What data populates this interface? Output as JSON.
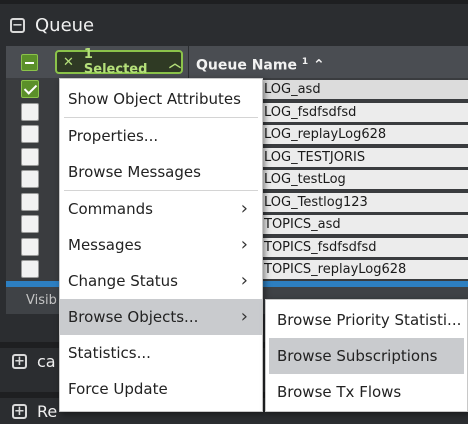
{
  "panel": {
    "title": "Queue",
    "collapse_icon": "minus-square-icon"
  },
  "grid": {
    "selection_chip": {
      "clear_icon": "close-icon",
      "label": "1 Selected",
      "chevron": "chevron-up-icon"
    },
    "column": {
      "name": "Queue Name",
      "sort_index": "1",
      "sort_icon": "sort-asc-icon"
    },
    "rows": [
      {
        "name": "LOG_asd",
        "selected": true
      },
      {
        "name": "LOG_fsdfsdfsd",
        "selected": false
      },
      {
        "name": "LOG_replayLog628",
        "selected": false
      },
      {
        "name": "LOG_TESTJORIS",
        "selected": false
      },
      {
        "name": "LOG_testLog",
        "selected": false
      },
      {
        "name": "LOG_Testlog123",
        "selected": false
      },
      {
        "name": "TOPICS_asd",
        "selected": false
      },
      {
        "name": "TOPICS_fsdfsdfsd",
        "selected": false
      },
      {
        "name": "TOPICS_replayLog628",
        "selected": false
      }
    ],
    "footer_text": "Visib"
  },
  "collapsed_panels": [
    {
      "title": "ca",
      "icon": "plus-square-icon"
    },
    {
      "title": "Re",
      "icon": "plus-square-icon"
    }
  ],
  "context_menu": {
    "items": [
      {
        "label": "Show Object Attributes",
        "has_submenu": false
      },
      {
        "label": "Properties...",
        "has_submenu": false
      },
      {
        "label": "Browse Messages",
        "has_submenu": false
      },
      {
        "label": "Commands",
        "has_submenu": true
      },
      {
        "label": "Messages",
        "has_submenu": true
      },
      {
        "label": "Change Status",
        "has_submenu": true
      },
      {
        "label": "Browse Objects...",
        "has_submenu": true,
        "active": true
      },
      {
        "label": "Statistics...",
        "has_submenu": false
      },
      {
        "label": "Force Update",
        "has_submenu": false
      }
    ]
  },
  "submenu": {
    "items": [
      {
        "label": "Browse Priority Statisti..."
      },
      {
        "label": "Browse Subscriptions",
        "highlighted": true
      },
      {
        "label": "Browse Tx Flows"
      }
    ]
  }
}
